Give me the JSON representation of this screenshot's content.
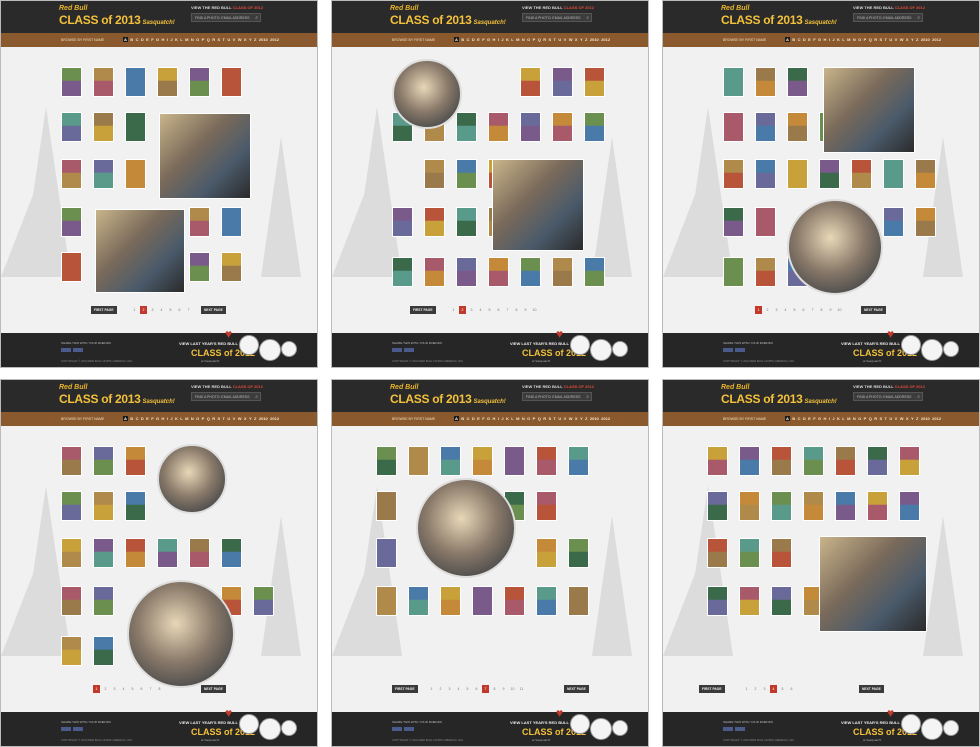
{
  "header": {
    "brand": "Red Bull",
    "class_title": "CLASS of 2013",
    "sasquatch": "Sasquatch!",
    "top_link": "VIEW THE RED BULL",
    "top_link_highlight": "CLASS OF 2012",
    "search_placeholder": "FIND A PHOTO: EMAIL ADDRESS"
  },
  "nav": {
    "browse_label": "BROWSE BY FIRST NAME",
    "letters": [
      "A",
      "B",
      "C",
      "D",
      "E",
      "F",
      "G",
      "H",
      "I",
      "J",
      "K",
      "L",
      "M",
      "N",
      "O",
      "P",
      "Q",
      "R",
      "S",
      "T",
      "U",
      "V",
      "W",
      "X",
      "Y",
      "Z"
    ],
    "extra": [
      "2010",
      "2012"
    ]
  },
  "pagination": {
    "first_page": "FIRST PAGE",
    "next_page": "NEXT PAGE"
  },
  "footer": {
    "share_label": "SHARE THIS WITH YOUR FRIENDS",
    "view_label": "VIEW LAST YEAR'S RED BULL",
    "class_2012": "CLASS of 2012",
    "at_sasquatch": "at Sasquatch!",
    "copyright": "COPYRIGHT © 2013 RED BULL NORTH AMERICA, INC."
  },
  "panels": [
    {
      "active_letter": "A",
      "pages": [
        "1",
        "2",
        "3",
        "4",
        "5",
        "6",
        "7"
      ],
      "active_page": "2"
    },
    {
      "active_letter": "A",
      "pages": [
        "1",
        "2",
        "3",
        "4",
        "5",
        "6",
        "7",
        "8",
        "9",
        "10"
      ],
      "active_page": "2"
    },
    {
      "active_letter": "A",
      "pages": [
        "1",
        "2",
        "3",
        "4",
        "5",
        "6",
        "7",
        "8",
        "9",
        "10"
      ],
      "active_page": "1"
    },
    {
      "active_letter": "A",
      "pages": [
        "1",
        "2",
        "3",
        "4",
        "5",
        "6",
        "7",
        "8"
      ],
      "active_page": "1"
    },
    {
      "active_letter": "A",
      "pages": [
        "1",
        "2",
        "3",
        "4",
        "5",
        "6",
        "7",
        "8",
        "9",
        "10",
        "11"
      ],
      "active_page": "7"
    },
    {
      "active_letter": "A",
      "pages": [
        "1",
        "2",
        "3",
        "4",
        "5",
        "6"
      ],
      "active_page": "4"
    }
  ],
  "colors": {
    "header_bg": "#2a2a2a",
    "nav_bg": "#8a5a2e",
    "accent_yellow": "#f3c13a",
    "active_red": "#c0392b"
  }
}
